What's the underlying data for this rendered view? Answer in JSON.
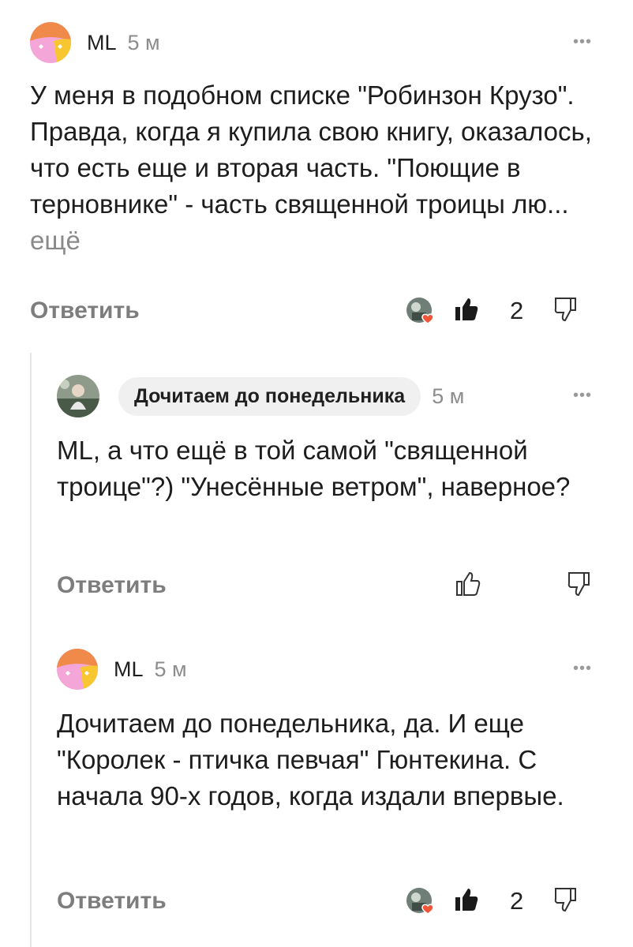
{
  "comments": [
    {
      "author": "ML",
      "time": "5 м",
      "text": "У меня в подобном списке \"Робинзон Крузо\". Правда, когда я купила свою книгу, оказалось, что есть еще и вторая часть. \"Поющие в терновнике\" - часть священной троицы лю...",
      "more": "ещё",
      "reply": "Ответить",
      "likes": "2"
    },
    {
      "author": "Дочитаем до понедельника",
      "time": "5 м",
      "text": "ML, а что ещё в той самой \"священной троице\"?) \"Унесённые ветром\", наверное?",
      "reply": "Ответить"
    },
    {
      "author": "ML",
      "time": "5 м",
      "text": "Дочитаем до понедельника, да. И еще \"Королек - птичка певчая\" Гюнтекина. С начала 90-х годов, когда издали впервые.",
      "reply": "Ответить",
      "likes": "2"
    }
  ],
  "menu_glyph": "•••",
  "icons": {
    "avatar_ml": "ml-avatar",
    "avatar_channel": "channel-avatar",
    "like": "thumbs-up-icon",
    "dislike": "thumbs-down-icon",
    "reactor": "reactor-avatar-heart"
  },
  "colors": {
    "avatar_orange": "#f08a4b",
    "avatar_pink": "#f4a6d9",
    "avatar_yellow": "#f7c631",
    "heart": "#f0553a"
  }
}
